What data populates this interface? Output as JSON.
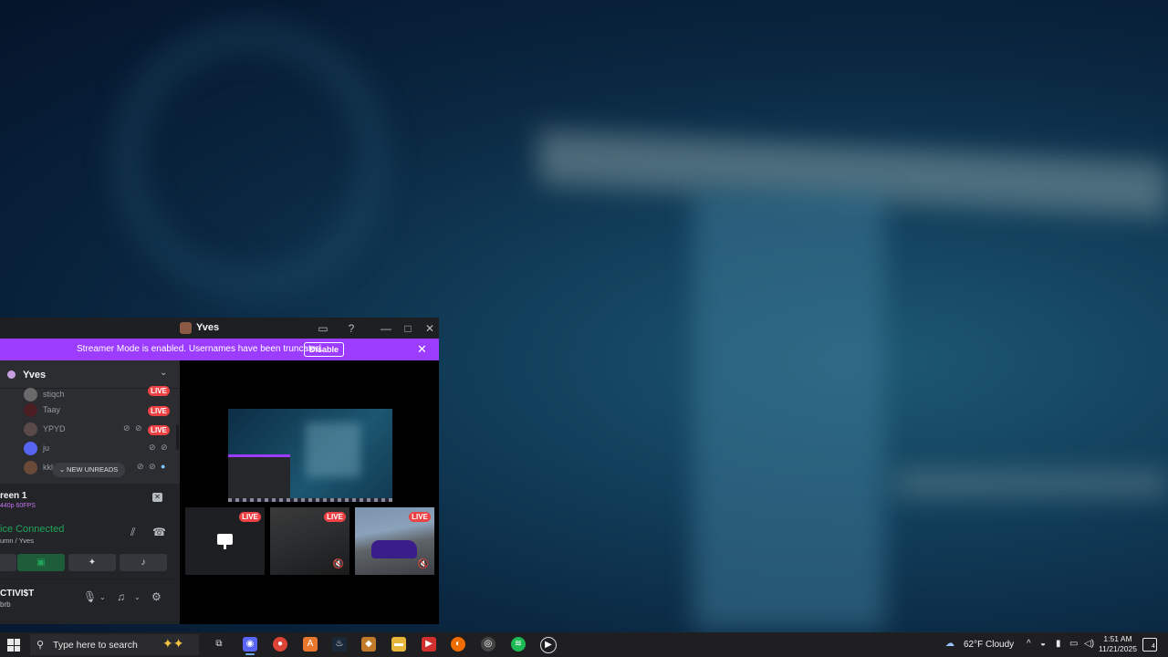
{
  "window": {
    "title": "Yves",
    "controls": [
      "inbox-icon",
      "help-icon",
      "minimize-icon",
      "maximize-icon",
      "close-icon"
    ]
  },
  "streamer_bar": {
    "message": "Streamer Mode is enabled. Usernames have been truncated.",
    "disable_label": "Disable",
    "close_icon": "✕",
    "color": "#9c3cff"
  },
  "sidebar": {
    "server_name": "Yves",
    "members": [
      {
        "name": "stiqch",
        "live": "LIVE"
      },
      {
        "name": "Taay",
        "live": "LIVE"
      },
      {
        "name": "YPYD",
        "live": "LIVE"
      },
      {
        "name": "ju",
        "live": ""
      },
      {
        "name": "kkk",
        "live": ""
      }
    ],
    "new_unreads": "⌄ NEW UNREADS"
  },
  "screen_panel": {
    "title": "reen 1",
    "subtitle": "440p 60FPS"
  },
  "voice": {
    "status": "ice Connected",
    "channel": "umn / Yves",
    "status_color": "#23a55a"
  },
  "user": {
    "name": "CTIVI$T",
    "status": "brb"
  },
  "stage": {
    "tiles": [
      {
        "badge": "LIVE"
      },
      {
        "badge": "LIVE"
      },
      {
        "badge": "LIVE"
      }
    ]
  },
  "taskbar": {
    "search_placeholder": "Type here to search",
    "weather_temp": "62°F",
    "weather_desc": "Cloudy",
    "time": "1:51 AM",
    "date": "11/21/2025",
    "notification_count": "4"
  }
}
